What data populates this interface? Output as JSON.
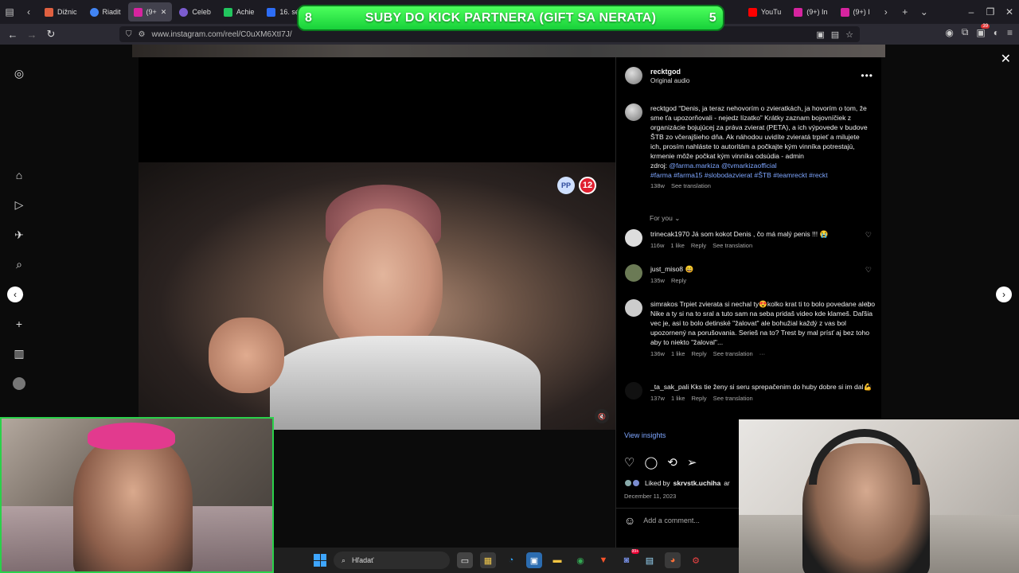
{
  "browser": {
    "tabs": [
      {
        "label": "Dižnic",
        "color": "#e06040"
      },
      {
        "label": "Riadit",
        "color": "#4285f4"
      },
      {
        "label": "(9+",
        "color": "#d6249f",
        "active": true
      },
      {
        "label": "Celeb",
        "color": "#7b5ccf"
      },
      {
        "label": "Achie",
        "color": "#22c55e"
      },
      {
        "label": "16. sé",
        "color": "#2d6df6"
      },
      {
        "label": "YouTu",
        "color": "#ff0000"
      },
      {
        "label": "(9+) In",
        "color": "#d6249f"
      },
      {
        "label": "(9+) I",
        "color": "#d6249f"
      }
    ],
    "url": "www.instagram.com/reel/C0uXM6XtI7J/",
    "extension_badge": "39"
  },
  "banner": {
    "text": "SUBY DO KICK PARTNERA (GIFT SA NERATA)",
    "left_number": "8",
    "right_number": "5"
  },
  "video": {
    "badge_pp": "PP",
    "badge_age": "12"
  },
  "post": {
    "username": "recktgod",
    "audio": "Original audio",
    "caption_user": "recktgod",
    "caption": "“Denis, ja teraz nehovorím o zvieratkách, ja hovorím o tom, že sme ťa upozorňovali - nejedz lízatko” Krátky zaznam bojovníčiek z organizácie bojujúcej za práva zvierat (PETA), a ich výpovede v budove ŠTB zo včerajšieho dňa. Ak náhodou uvidíte zvieratá trpieť a milujete ich, prosím nahláste to autoritám a počkajte kým vinníka potrestajú, krmenie môže počkat kým vinníka odsúdia - admin",
    "source_label": "zdroj:",
    "mentions": "@farma.markiza @tvmarkizaofficial",
    "hashtags": "#farma #farma15 #slobodazvierat #ŠTB #teamreckt #reckt",
    "caption_age": "138w",
    "see_translation": "See translation",
    "for_you": "For you",
    "view_insights": "View insights",
    "liked_by_prefix": "Liked by",
    "liked_by_user": "skrvstk.uchiha",
    "liked_by_suffix": "ar",
    "date": "December 11, 2023",
    "add_comment": "Add a comment..."
  },
  "comments": [
    {
      "user": "trinecak1970",
      "text": "Já som kokot Denis , čo má malý penis !!! 😭",
      "age": "116w",
      "likes": "1 like",
      "reply": "Reply",
      "translate": "See translation"
    },
    {
      "user": "just_miso8",
      "text": "😄",
      "age": "135w",
      "likes": "",
      "reply": "Reply",
      "translate": ""
    },
    {
      "user": "simrakos",
      "text": "Trpiet zvierata si nechal ty😍kolko krat ti to bolo povedane alebo Nike a ty si na to sral a tuto sam na seba pridaš video kde klameš. Daľšia vec je, asi to bolo detinské \"žalovat\" ale bohužial každý z vas bol upozornený na porušovania. Serieš na to? Trest by mal prísť aj bez toho aby to niekto \"žaloval\"...",
      "age": "136w",
      "likes": "1 like",
      "reply": "Reply",
      "translate": "See translation",
      "more": "···"
    },
    {
      "user": "_ta_sak_pali",
      "text": "Kks tie ženy si seru sprepačenim do huby dobre si im dal💪",
      "age": "137w",
      "likes": "1 like",
      "reply": "Reply",
      "translate": "See translation"
    }
  ],
  "taskbar": {
    "search_label": "Hľadať",
    "discord_badge": "99+"
  }
}
